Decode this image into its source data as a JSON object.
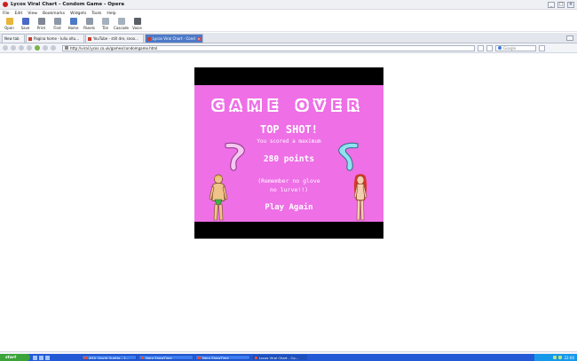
{
  "window": {
    "title": "Lycos Viral Chart - Condom Game - Opera",
    "controls": [
      "_",
      "□",
      "×"
    ]
  },
  "menu": [
    "File",
    "Edit",
    "View",
    "Bookmarks",
    "Widgets",
    "Tools",
    "Help"
  ],
  "toolbar": [
    {
      "label": "Open",
      "icon": "folder-icon",
      "color": "#e8b53a"
    },
    {
      "label": "Save",
      "icon": "save-icon",
      "color": "#4a69c9"
    },
    {
      "label": "Print",
      "icon": "print-icon",
      "color": "#7f8795"
    },
    {
      "label": "Find",
      "icon": "find-icon",
      "color": "#8f98a8"
    },
    {
      "label": "Home",
      "icon": "home-icon",
      "color": "#4d79c7"
    },
    {
      "label": "Panels",
      "icon": "panels-icon",
      "color": "#8f98a8"
    },
    {
      "label": "Tile",
      "icon": "tile-icon",
      "color": "#a7b0be"
    },
    {
      "label": "Cascade",
      "icon": "cascade-icon",
      "color": "#a7b0be"
    },
    {
      "label": "Voice",
      "icon": "voice-icon",
      "color": "#5a5f68"
    }
  ],
  "tabs": [
    {
      "label": "New tab",
      "active": false,
      "wide": false
    },
    {
      "label": "Pagina home - Iuliu oltu...",
      "active": false,
      "wide": true
    },
    {
      "label": "YouTube - still dre, snoo...",
      "active": false,
      "wide": true
    },
    {
      "label": "Lycos Viral Chart - Cond...",
      "active": true,
      "wide": true
    }
  ],
  "address": {
    "url": "http://viral.lycos.co.uk/games/condomgame.html",
    "search_placeholder": "Google"
  },
  "game": {
    "header": "GAME OVER",
    "title": "TOP SHOT!",
    "subtitle": "You scored a maximum",
    "points": "280 points",
    "note_line1": "(Remember no glove",
    "note_line2": "no lurve!!)",
    "play_again": "Play Again"
  },
  "taskbar": {
    "start_label": "start",
    "tasks": [
      {
        "label": "#4U_David Guetta - 1...",
        "active": false
      },
      {
        "label": "Nero ShowTime",
        "active": false
      },
      {
        "label": "Nero ShowTime",
        "active": false
      },
      {
        "label": "Lycos Viral Chart - Co...",
        "active": true
      }
    ],
    "clock": "22:00"
  },
  "colors": {
    "game_pink": "#ee6fe6",
    "taskbar_blue": "#2459d6",
    "start_green": "#3aa339"
  }
}
